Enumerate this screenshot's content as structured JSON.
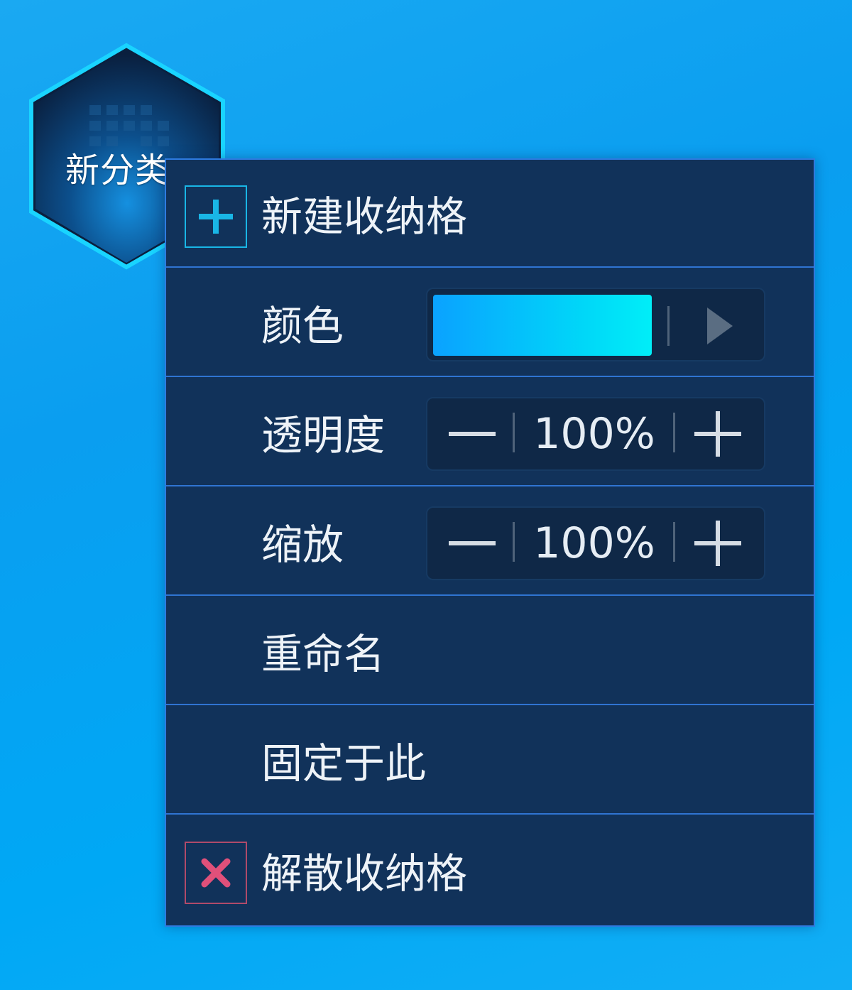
{
  "widget": {
    "label": "新分类",
    "icon": "hexagon-grid-icon",
    "accent": "#19d4ff"
  },
  "menu": {
    "new_item": {
      "label": "新建收纳格",
      "icon": "plus-icon"
    },
    "color": {
      "label": "颜色",
      "swatch_start": "#0aa2ff",
      "swatch_end": "#00eef8",
      "expand_icon": "triangle-right-icon"
    },
    "opacity": {
      "label": "透明度",
      "value": "100%",
      "minus_icon": "minus-icon",
      "plus_icon": "plus-icon"
    },
    "scale": {
      "label": "缩放",
      "value": "100%",
      "minus_icon": "minus-icon",
      "plus_icon": "plus-icon"
    },
    "rename": {
      "label": "重命名"
    },
    "pin": {
      "label": "固定于此"
    },
    "dissolve": {
      "label": "解散收纳格",
      "icon": "close-icon",
      "accent": "#e0507a"
    }
  },
  "colors": {
    "menu_bg": "#11325a",
    "menu_border": "#2e7be0",
    "divider": "#2f74d2",
    "text": "#eef3f8",
    "add_accent": "#19b6e6"
  }
}
